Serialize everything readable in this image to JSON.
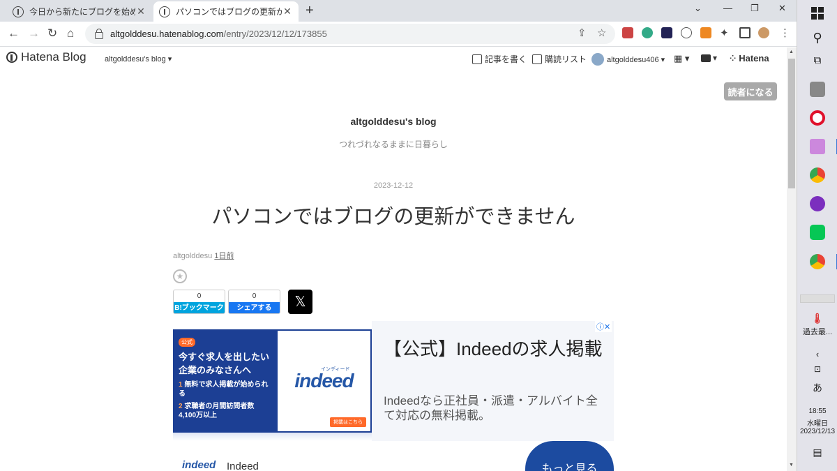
{
  "browser": {
    "tabs": [
      {
        "title": "今日から新たにブログを始めました -"
      },
      {
        "title": "パソコンではブログの更新ができませ/"
      }
    ],
    "new_tab": "+",
    "url_host": "altgolddesu.hatenablog.com",
    "url_path": "/entry/2023/12/12/173855",
    "win_minimize": "⌄",
    "win_min": "—",
    "win_max": "❐",
    "win_close": "✕"
  },
  "hatena": {
    "logo_text": "Hatena Blog",
    "blog_dropdown": "altgolddesu's blog ▾",
    "write": "記事を書く",
    "reading_list": "購読リスト",
    "user": "altgolddesu406 ▾",
    "apps": "▦ ▾",
    "notify": "▾",
    "brand": "Hatena",
    "subscribe": "読者になる"
  },
  "blog": {
    "title": "altgolddesu's blog",
    "description": "つれづれなるままに日暮らし"
  },
  "post": {
    "date": "2023-12-12",
    "title": "パソコンではブログの更新ができません",
    "author": "altgolddesu",
    "relative_time": "1日前",
    "bookmark_count": "0",
    "bookmark_label": "B!ブックマーク",
    "share_count": "0",
    "share_label": "シェアする",
    "x_label": "𝕏"
  },
  "ad": {
    "badge": "公式",
    "headline_img": "今すぐ求人を出したい企業のみなさんへ",
    "point1": "無料で求人掲載が始められる",
    "point1_num": "1",
    "point2": "求職者の月間訪問者数 4,100万以上",
    "point2_num": "2",
    "logo": "indeed",
    "logo_kana": "インディード",
    "img_cta": "掲載はこちら",
    "title": "【公式】Indeedの求人掲載",
    "desc": "Indeedなら正社員・派遣・アルバイト全て対応の無料掲載。",
    "advertiser": "Indeed",
    "more": "もっと見る",
    "choices": "ⓘ✕"
  },
  "taskbar": {
    "temp_label": "過去最...",
    "ime": "あ",
    "time": "18:55",
    "weekday": "水曜日",
    "date": "2023/12/13"
  }
}
